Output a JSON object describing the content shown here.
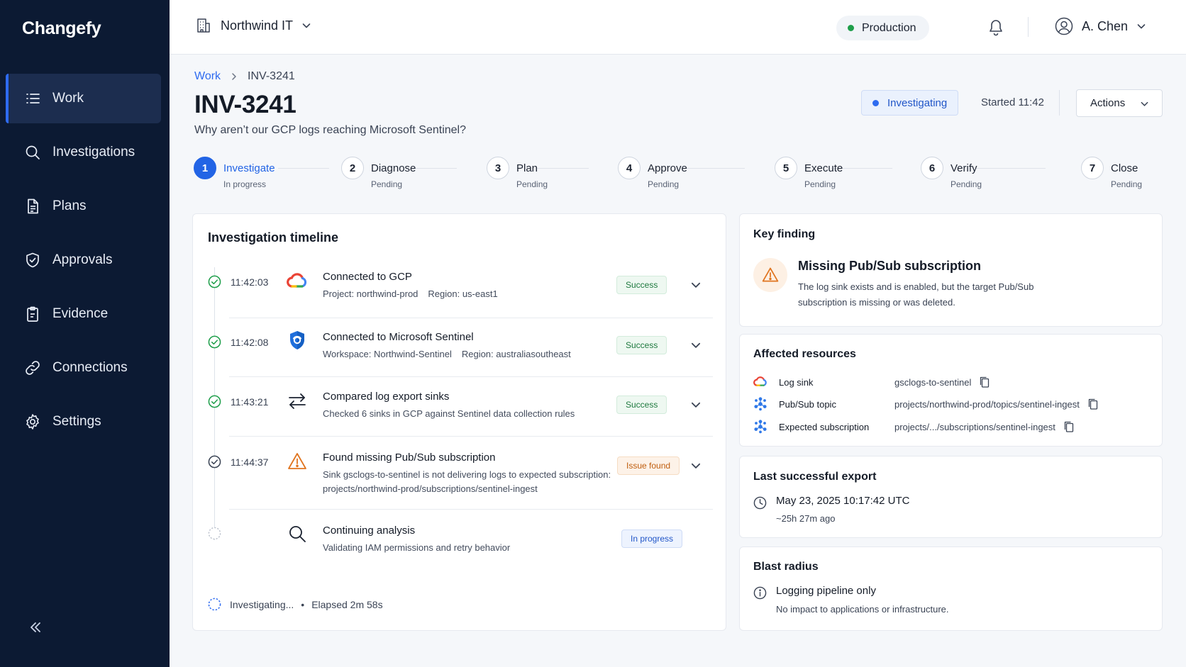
{
  "app": {
    "name": "Changefy"
  },
  "sidebar": {
    "items": [
      {
        "label": "Work",
        "icon": "list-icon",
        "active": true
      },
      {
        "label": "Investigations",
        "icon": "search-icon"
      },
      {
        "label": "Plans",
        "icon": "document-icon"
      },
      {
        "label": "Approvals",
        "icon": "shield-check-icon"
      },
      {
        "label": "Evidence",
        "icon": "clipboard-icon"
      },
      {
        "label": "Connections",
        "icon": "link-icon"
      },
      {
        "label": "Settings",
        "icon": "gear-icon"
      }
    ],
    "collapse_icon": "double-chevron-left-icon"
  },
  "topbar": {
    "org": "Northwind IT",
    "environment": "Production",
    "environment_color": "#1e9e4a",
    "user": "A. Chen"
  },
  "breadcrumb": {
    "parent": "Work",
    "current": "INV-3241"
  },
  "header": {
    "title": "INV-3241",
    "subtitle": "Why aren’t our GCP logs reaching Microsoft Sentinel?",
    "status": "Investigating",
    "started": "Started 11:42",
    "actions_label": "Actions"
  },
  "stepper": [
    {
      "num": "1",
      "label": "Investigate",
      "status": "In progress",
      "active": true
    },
    {
      "num": "2",
      "label": "Diagnose",
      "status": "Pending"
    },
    {
      "num": "3",
      "label": "Plan",
      "status": "Pending"
    },
    {
      "num": "4",
      "label": "Approve",
      "status": "Pending"
    },
    {
      "num": "5",
      "label": "Execute",
      "status": "Pending"
    },
    {
      "num": "6",
      "label": "Verify",
      "status": "Pending"
    },
    {
      "num": "7",
      "label": "Close",
      "status": "Pending"
    }
  ],
  "timeline": {
    "title": "Investigation timeline",
    "events": [
      {
        "time": "11:42:03",
        "icon": "gcp-cloud-icon",
        "title": "Connected to GCP",
        "details": [
          "Project: northwind-prod",
          "Region: us-east1"
        ],
        "badge": "Success"
      },
      {
        "time": "11:42:08",
        "icon": "sentinel-shield-icon",
        "title": "Connected to Microsoft Sentinel",
        "details": [
          "Workspace: Northwind-Sentinel",
          "Region: australiasoutheast"
        ],
        "badge": "Success"
      },
      {
        "time": "11:43:21",
        "icon": "compare-arrows-icon",
        "title": "Compared log export sinks",
        "details": [
          "Checked 6 sinks in GCP against Sentinel data collection rules"
        ],
        "badge": "Success"
      },
      {
        "time": "11:44:37",
        "icon": "warning-icon",
        "title": "Found missing Pub/Sub subscription",
        "details": [
          "Sink gsclogs-to-sentinel is not delivering logs to expected subscription: projects/northwind-prod/subscriptions/sentinel-ingest"
        ],
        "badge": "Issue found"
      },
      {
        "time": "",
        "icon": "search-icon",
        "title": "Continuing analysis",
        "details": [
          "Validating IAM permissions and retry behavior"
        ],
        "badge": "In progress"
      }
    ],
    "footer_status": "Investigating...",
    "footer_elapsed": "Elapsed 2m 58s"
  },
  "key_finding": {
    "heading": "Key finding",
    "title": "Missing Pub/Sub subscription",
    "description": "The log sink exists and is enabled, but the target Pub/Sub subscription is missing or was deleted."
  },
  "affected": {
    "heading": "Affected resources",
    "rows": [
      {
        "icon": "gcp-cloud-icon",
        "type": "Log sink",
        "value": "gsclogs-to-sentinel"
      },
      {
        "icon": "pubsub-icon",
        "type": "Pub/Sub topic",
        "value": "projects/northwind-prod/topics/sentinel-ingest"
      },
      {
        "icon": "pubsub-icon",
        "type": "Expected subscription",
        "value": "projects/.../subscriptions/sentinel-ingest"
      }
    ]
  },
  "last_export": {
    "heading": "Last successful export",
    "timestamp": "May 23, 2025 10:17:42 UTC",
    "ago": "~25h 27m ago"
  },
  "blast_radius": {
    "heading": "Blast radius",
    "title": "Logging pipeline only",
    "description": "No impact to applications or infrastructure."
  }
}
